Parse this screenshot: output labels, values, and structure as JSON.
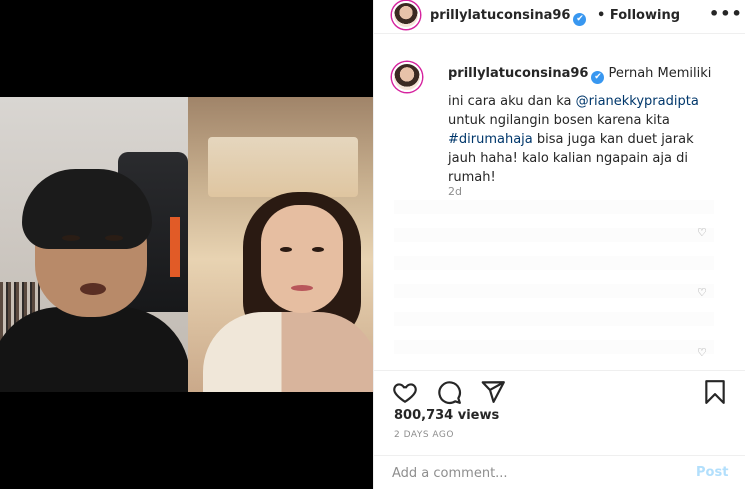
{
  "header": {
    "username": "prillylatuconsina96",
    "follow_status": "Following",
    "more": "•••"
  },
  "caption": {
    "username": "prillylatuconsina96",
    "extra": "Pernah Memiliki",
    "text_part1": "ini cara aku dan ka ",
    "mention": "@rianekkypradipta",
    "text_part2": " untuk ngilangin bosen karena kita ",
    "hashtag": "#dirumahaja",
    "text_part3": " bisa juga kan duet jarak jauh haha! kalo kalian ngapain aja di rumah!",
    "time_ago": "2d"
  },
  "stats": {
    "views": "800,734 views",
    "posted": "2 DAYS AGO"
  },
  "comment": {
    "placeholder": "Add a comment...",
    "post_label": "Post"
  },
  "icons": {
    "verified": "✔",
    "heart": "heart-icon",
    "comment": "comment-icon",
    "share": "share-icon",
    "save": "bookmark-icon"
  },
  "colors": {
    "verified": "#3897f0",
    "link": "#00376b",
    "post_disabled": "#b2dffc"
  }
}
